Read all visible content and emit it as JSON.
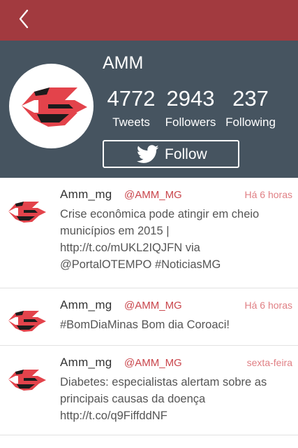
{
  "colors": {
    "header": "#a23a3f",
    "profile_bg": "#465460",
    "accent": "#c9454b",
    "timestamp": "#e07f84"
  },
  "nav": {
    "back_icon": "chevron-left-icon"
  },
  "profile": {
    "name": "AMM",
    "stats": [
      {
        "value": "4772",
        "label": "Tweets"
      },
      {
        "value": "2943",
        "label": "Followers"
      },
      {
        "value": "237",
        "label": "Following"
      }
    ],
    "follow": {
      "icon": "twitter-bird-icon",
      "label": "Follow"
    }
  },
  "tweets": [
    {
      "name": "Amm_mg",
      "handle": "@AMM_MG",
      "time": "Há 6 horas",
      "text": "Crise econômica pode atingir em cheio municípios em 2015 | http://t.co/mUKL2IQJFN via @PortalOTEMPO #NoticiasMG"
    },
    {
      "name": "Amm_mg",
      "handle": "@AMM_MG",
      "time": "Há 6 horas",
      "text": "#BomDiaMinas Bom dia Coroaci!"
    },
    {
      "name": "Amm_mg",
      "handle": "@AMM_MG",
      "time": "sexta-feira",
      "text": "Diabetes: especialistas alertam sobre as principais causas da doença http://t.co/q9FiffddNF"
    }
  ]
}
